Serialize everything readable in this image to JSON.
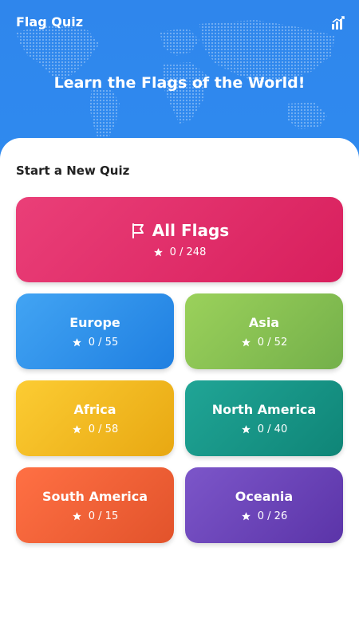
{
  "header": {
    "app_title": "Flag Quiz",
    "hero_title": "Learn the Flags of the World!",
    "stats_icon": "bar-chart-icon",
    "background_color": "#2f87ee"
  },
  "main": {
    "section_title": "Start a New Quiz",
    "cards": [
      {
        "name": "All Flags",
        "score": "0 / 248",
        "icon": "flag-icon",
        "color": "#e0306a"
      },
      {
        "name": "Europe",
        "score": "0 / 55",
        "icon": "star-icon",
        "color": "#3392ea"
      },
      {
        "name": "Asia",
        "score": "0 / 52",
        "icon": "star-icon",
        "color": "#8cc152"
      },
      {
        "name": "Africa",
        "score": "0 / 58",
        "icon": "star-icon",
        "color": "#f6bb22"
      },
      {
        "name": "North America",
        "score": "0 / 40",
        "icon": "star-icon",
        "color": "#179585"
      },
      {
        "name": "South America",
        "score": "0 / 15",
        "icon": "star-icon",
        "color": "#f1613a"
      },
      {
        "name": "Oceania",
        "score": "0 / 26",
        "icon": "star-icon",
        "color": "#6c45b9"
      }
    ]
  }
}
